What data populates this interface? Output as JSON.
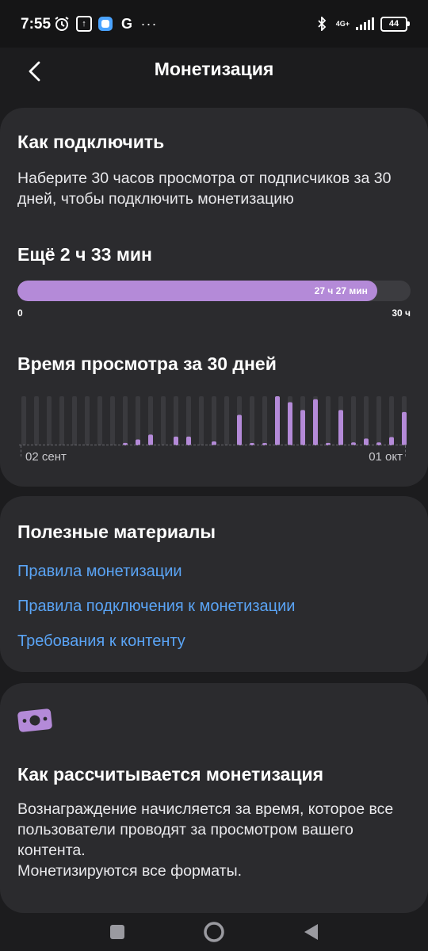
{
  "status_bar": {
    "time": "7:55",
    "network_label_top": "4G+",
    "battery_level": "44",
    "icons": [
      "alarm-icon",
      "upload-icon",
      "app-icon",
      "google-icon",
      "more-dots-icon",
      "bluetooth-icon",
      "signal-icon",
      "battery-icon"
    ]
  },
  "app_bar": {
    "title": "Монетизация",
    "back_icon": "chevron-left-icon"
  },
  "connect_card": {
    "title": "Как подключить",
    "description": "Наберите 30 часов просмотра от подписчиков за 30 дней, чтобы подключить монетизацию",
    "remaining": "Ещё 2 ч 33 мин",
    "progress": {
      "fraction": 0.915,
      "current_label": "27 ч 27 мин",
      "min_label": "0",
      "max_label": "30 ч"
    },
    "chart_title": "Время просмотра за 30 дней",
    "chart_data": {
      "type": "bar",
      "x_start_label": "02 сент",
      "x_end_label": "01 окт",
      "values": [
        0,
        0,
        0,
        0,
        0,
        0,
        0,
        0,
        0.05,
        0.12,
        0.22,
        0,
        0.18,
        0.18,
        0,
        0.08,
        0,
        0.62,
        0.03,
        0.03,
        1.0,
        0.88,
        0.72,
        0.94,
        0.05,
        0.72,
        0.06,
        0.14,
        0.06,
        0.17,
        0.68
      ],
      "ylim": [
        0,
        1
      ],
      "bar_color": "#b48ad8",
      "track_color": "#3a3a3e"
    }
  },
  "materials_card": {
    "title": "Полезные материалы",
    "links": [
      "Правила монетизации",
      "Правила подключения к монетизации",
      "Требования к контенту"
    ]
  },
  "calc_card": {
    "icon": "money-icon",
    "title": "Как рассчитывается монетизация",
    "description_line1": "Вознаграждение начисляется за время, которое все пользователи проводят за просмотром вашего контента.",
    "description_line2": "Монетизируются все форматы."
  },
  "nav_bar": {
    "buttons": [
      "recents-square-icon",
      "home-circle-icon",
      "back-triangle-icon"
    ]
  },
  "colors": {
    "accent": "#b48ad8",
    "link": "#5aa4f5",
    "card_bg": "#2b2b2e",
    "page_bg": "#1c1c1e"
  }
}
